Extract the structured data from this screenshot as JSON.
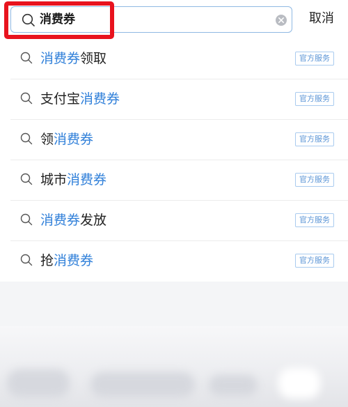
{
  "search": {
    "query": "消费券",
    "cancel_label": "取消"
  },
  "suggestions": [
    {
      "before": "",
      "highlight": "消费券",
      "after": "领取",
      "tag": "官方服务"
    },
    {
      "before": "支付宝",
      "highlight": "消费券",
      "after": "",
      "tag": "官方服务"
    },
    {
      "before": "领",
      "highlight": "消费券",
      "after": "",
      "tag": "官方服务"
    },
    {
      "before": "城市",
      "highlight": "消费券",
      "after": "",
      "tag": "官方服务"
    },
    {
      "before": "",
      "highlight": "消费券",
      "after": "发放",
      "tag": "官方服务"
    },
    {
      "before": "抢",
      "highlight": "消费券",
      "after": "",
      "tag": "官方服务"
    }
  ],
  "icons": {
    "search": "search-icon",
    "clear": "clear-icon",
    "suggestion": "search-icon"
  },
  "colors": {
    "highlight_text": "#2f7fd9",
    "annotation_red": "#e8131e",
    "input_border": "#8fb9e3",
    "tag_border": "#a9cbef"
  }
}
